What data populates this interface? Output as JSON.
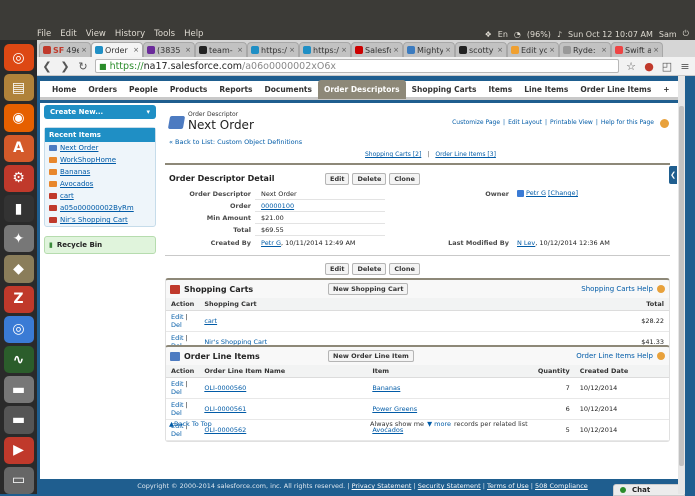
{
  "os": {
    "menu": [
      "File",
      "Edit",
      "View",
      "History",
      "Tools",
      "Help"
    ],
    "tray": {
      "lang": "En",
      "battery": "(96%)",
      "clock": "Sun Oct 12 10:07 AM",
      "user": "Sam"
    }
  },
  "launcher": [
    {
      "name": "ubuntu-icon",
      "color": "#dd4814",
      "glyph": "◎"
    },
    {
      "name": "files-icon",
      "color": "#b0823a",
      "glyph": "▤"
    },
    {
      "name": "firefox-icon",
      "color": "#e66000",
      "glyph": "◉"
    },
    {
      "name": "software-center-icon",
      "color": "#d45a2a",
      "glyph": "A"
    },
    {
      "name": "settings-icon",
      "color": "#c0392b",
      "glyph": "⚙"
    },
    {
      "name": "terminal-icon",
      "color": "#333",
      "glyph": "▮"
    },
    {
      "name": "joystick-icon",
      "color": "#777",
      "glyph": "✦"
    },
    {
      "name": "gimp-icon",
      "color": "#8a7d5a",
      "glyph": "◆"
    },
    {
      "name": "filezilla-icon",
      "color": "#c0392b",
      "glyph": "Z"
    },
    {
      "name": "chromium-icon",
      "color": "#3a7bd5",
      "glyph": "◎"
    },
    {
      "name": "system-monitor-icon",
      "color": "#2b5d2b",
      "glyph": "∿"
    },
    {
      "name": "drive-icon",
      "color": "#777",
      "glyph": "▬"
    },
    {
      "name": "sd-card-icon",
      "color": "#555",
      "glyph": "▬"
    },
    {
      "name": "tube-icon",
      "color": "#c0392b",
      "glyph": "▶"
    },
    {
      "name": "trash-icon",
      "color": "#666",
      "glyph": "▭"
    }
  ],
  "browser": {
    "tabs": [
      {
        "label": "49ers",
        "prefix": "SF",
        "color": "#c0392b",
        "active": false
      },
      {
        "label": "Order",
        "color": "#1f8fc5",
        "active": true
      },
      {
        "label": "(3835",
        "color": "#6a2a9a",
        "active": false
      },
      {
        "label": "team-",
        "color": "#222",
        "active": false
      },
      {
        "label": "https:/",
        "color": "#1f8fc5",
        "active": false
      },
      {
        "label": "https:/",
        "color": "#1f8fc5",
        "active": false
      },
      {
        "label": "Salesfo",
        "color": "#cc0000",
        "active": false
      },
      {
        "label": "Mighty",
        "color": "#3b7bbf",
        "active": false
      },
      {
        "label": "scotty",
        "color": "#222",
        "active": false
      },
      {
        "label": "Edit yo",
        "color": "#f0a030",
        "active": false
      },
      {
        "label": "Ryde:",
        "color": "#999",
        "active": false
      },
      {
        "label": "Swift a",
        "color": "#e44",
        "active": false
      }
    ],
    "url": {
      "scheme": "https://",
      "host": "na17.salesforce.com",
      "path": "/a06o0000002xO6x"
    }
  },
  "sfnav": {
    "tabs": [
      "Home",
      "Orders",
      "People",
      "Products",
      "Reports",
      "Documents",
      "Order Descriptors",
      "Shopping Carts",
      "Items",
      "Line Items",
      "Order Line Items",
      "+"
    ],
    "active": "Order Descriptors"
  },
  "sidebar": {
    "create": "Create New...",
    "recent_title": "Recent Items",
    "recent": [
      {
        "label": "Next Order",
        "color": "#4d7bc1"
      },
      {
        "label": "WorkShopHome",
        "color": "#e8872c"
      },
      {
        "label": "Bananas",
        "color": "#e8872c"
      },
      {
        "label": "Avocados",
        "color": "#e8872c"
      },
      {
        "label": "cart",
        "color": "#c0392b"
      },
      {
        "label": "a05o00000002ByRm",
        "color": "#c0392b"
      },
      {
        "label": "Nir's Shopping Cart",
        "color": "#c0392b"
      }
    ],
    "recycle": "Recycle Bin"
  },
  "header": {
    "subtitle": "Order Descriptor",
    "title": "Next Order",
    "links": [
      "Customize Page",
      "Edit Layout",
      "Printable View",
      "Help for this Page"
    ],
    "back": "« Back to List: Custom Object Definitions",
    "related_links": [
      "Shopping Carts [2]",
      "Order Line Items [3]"
    ]
  },
  "detail": {
    "title": "Order Descriptor Detail",
    "buttons": [
      "Edit",
      "Delete",
      "Clone"
    ],
    "fields": {
      "descriptor_label": "Order Descriptor",
      "descriptor_value": "Next Order",
      "owner_label": "Owner",
      "owner_value": "Petr G",
      "owner_change": "[Change]",
      "order_label": "Order",
      "order_value": "00000100",
      "min_label": "Min Amount",
      "min_value": "$21.00",
      "total_label": "Total",
      "total_value": "$69.55",
      "created_label": "Created By",
      "created_user": "Petr G",
      "created_date": ", 10/11/2014 12:49 AM",
      "modified_label": "Last Modified By",
      "modified_user": "N Lev",
      "modified_date": ", 10/12/2014 12:36 AM"
    }
  },
  "carts": {
    "title": "Shopping Carts",
    "new_button": "New Shopping Cart",
    "help": "Shopping Carts Help",
    "columns": [
      "Action",
      "Shopping Cart",
      "Total"
    ],
    "rows": [
      {
        "edit": "Edit",
        "del": "Del",
        "name": "cart",
        "total": "$28.22"
      },
      {
        "edit": "Edit",
        "del": "Del",
        "name": "Nir's Shopping Cart",
        "total": "$41.33"
      }
    ]
  },
  "lines": {
    "title": "Order Line Items",
    "new_button": "New Order Line Item",
    "help": "Order Line Items Help",
    "columns": [
      "Action",
      "Order Line Item Name",
      "Item",
      "Quantity",
      "Created Date"
    ],
    "rows": [
      {
        "edit": "Edit",
        "del": "Del",
        "name": "OLI-0000560",
        "item": "Bananas",
        "qty": "7",
        "date": "10/12/2014"
      },
      {
        "edit": "Edit",
        "del": "Del",
        "name": "OLI-0000561",
        "item": "Power Greens",
        "qty": "6",
        "date": "10/12/2014"
      },
      {
        "edit": "Edit",
        "del": "Del",
        "name": "OLI-0000562",
        "item": "Avocados",
        "qty": "5",
        "date": "10/12/2014"
      }
    ]
  },
  "bottom": {
    "back_top": "Back To Top",
    "always_show": "Always show me",
    "more": "more",
    "records": "records per related list"
  },
  "footer": {
    "copyright": "Copyright © 2000-2014 salesforce.com, inc. All rights reserved.",
    "links": [
      "Privacy Statement",
      "Security Statement",
      "Terms of Use",
      "508 Compliance"
    ]
  },
  "chat": {
    "label": "Chat"
  }
}
